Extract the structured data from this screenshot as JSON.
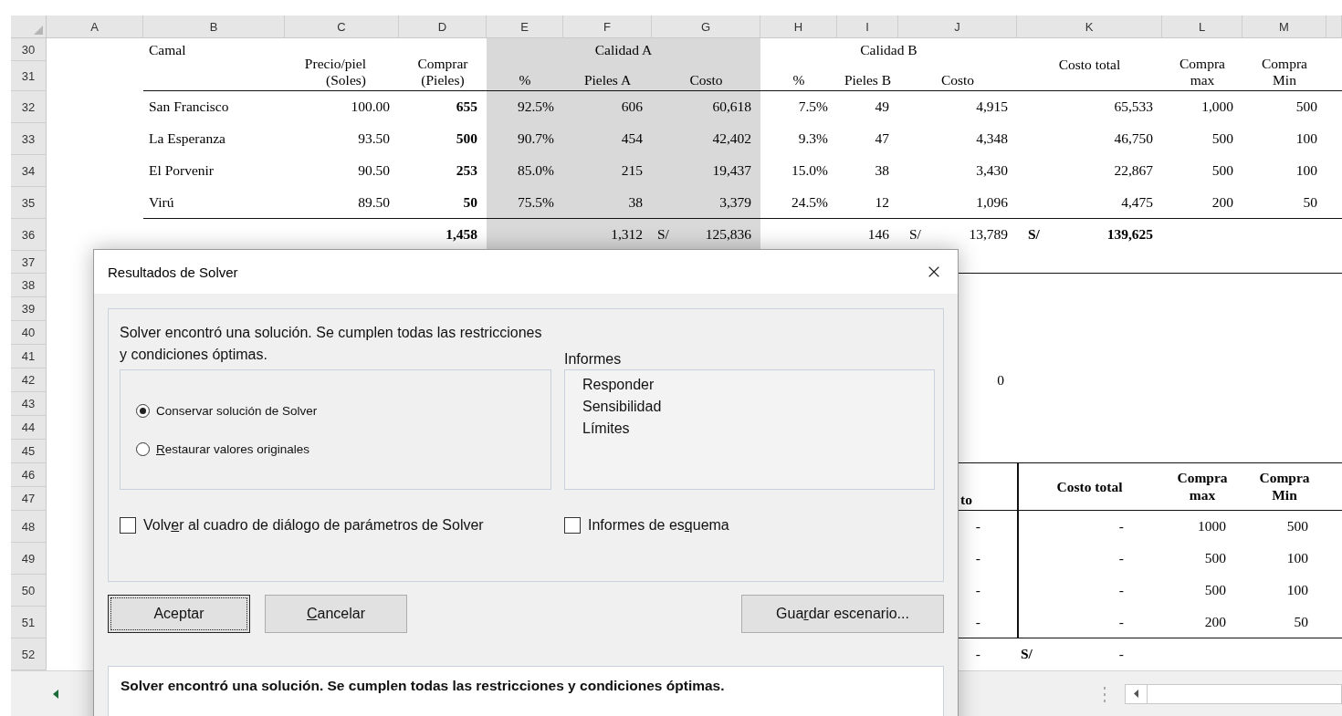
{
  "columns": [
    "A",
    "B",
    "C",
    "D",
    "E",
    "F",
    "G",
    "H",
    "I",
    "J",
    "K",
    "L",
    "M"
  ],
  "row_numbers": [
    "30",
    "31",
    "32",
    "33",
    "34",
    "35",
    "36",
    "37",
    "38",
    "39",
    "40",
    "41",
    "42",
    "43",
    "44",
    "45",
    "46",
    "47",
    "48",
    "49",
    "50",
    "51",
    "52"
  ],
  "top_table": {
    "header": {
      "camal": [
        "Camal"
      ],
      "precio": [
        "Precio/piel",
        "(Soles)"
      ],
      "comprar": [
        "Comprar",
        "(Pieles)"
      ],
      "calidad_a": [
        "Calidad A"
      ],
      "pct_a": [
        "%"
      ],
      "pieles_a": [
        "Pieles A"
      ],
      "costo_a": [
        "Costo"
      ],
      "calidad_b": [
        "Calidad B"
      ],
      "pct_b": [
        "%"
      ],
      "pieles_b": [
        "Pieles B"
      ],
      "costo_b": [
        "Costo"
      ],
      "costo_total": [
        "Costo total"
      ],
      "compra_max": [
        "Compra",
        "max"
      ],
      "compra_min": [
        "Compra",
        "Min"
      ]
    },
    "rows": [
      {
        "camal": "San Francisco",
        "precio": "100.00",
        "comprar": "655",
        "pct_a": "92.5%",
        "pieles_a": "606",
        "costo_a": "60,618",
        "pct_b": "7.5%",
        "pieles_b": "49",
        "costo_b": "4,915",
        "costo_total": "65,533",
        "compra_max": "1,000",
        "compra_min": "500"
      },
      {
        "camal": "La Esperanza",
        "precio": "93.50",
        "comprar": "500",
        "pct_a": "90.7%",
        "pieles_a": "454",
        "costo_a": "42,402",
        "pct_b": "9.3%",
        "pieles_b": "47",
        "costo_b": "4,348",
        "costo_total": "46,750",
        "compra_max": "500",
        "compra_min": "100"
      },
      {
        "camal": "El Porvenir",
        "precio": "90.50",
        "comprar": "253",
        "pct_a": "85.0%",
        "pieles_a": "215",
        "costo_a": "19,437",
        "pct_b": "15.0%",
        "pieles_b": "38",
        "costo_b": "3,430",
        "costo_total": "22,867",
        "compra_max": "500",
        "compra_min": "100"
      },
      {
        "camal": "Virú",
        "precio": "89.50",
        "comprar": "50",
        "pct_a": "75.5%",
        "pieles_a": "38",
        "costo_a": "3,379",
        "pct_b": "24.5%",
        "pieles_b": "12",
        "costo_b": "1,096",
        "costo_total": "4,475",
        "compra_max": "200",
        "compra_min": "50"
      }
    ],
    "totals": {
      "comprar": "1,458",
      "pieles_a": "1,312",
      "currency_a": "S/",
      "costo_a": "125,836",
      "pieles_b": "146",
      "currency_b": "S/",
      "costo_b": "13,789",
      "currency_total": "S/",
      "costo_total": "139,625"
    }
  },
  "stray_value": "0",
  "lower_table": {
    "header": {
      "costo": [
        "to"
      ],
      "costo_total": [
        "Costo total"
      ],
      "compra_max": [
        "Compra",
        "max"
      ],
      "compra_min": [
        "Compra",
        "Min"
      ]
    },
    "rows": [
      {
        "costo": "-",
        "costo_total": "-",
        "compra_max": "1000",
        "compra_min": "500"
      },
      {
        "costo": "-",
        "costo_total": "-",
        "compra_max": "500",
        "compra_min": "100"
      },
      {
        "costo": "-",
        "costo_total": "-",
        "compra_max": "500",
        "compra_min": "100"
      },
      {
        "costo": "-",
        "costo_total": "-",
        "compra_max": "200",
        "compra_min": "50"
      }
    ],
    "totals": {
      "costo": "-",
      "currency": "S/",
      "costo_total": "-"
    }
  },
  "dialog": {
    "title": "Resultados de Solver",
    "message": "Solver encontró una solución. Se cumplen todas las restricciones y condiciones óptimas.",
    "options": [
      {
        "label": {
          "before": "Conservar solución de Solver"
        },
        "selected": true
      },
      {
        "label": {
          "key": "R",
          "after": "estaurar valores originales"
        },
        "selected": false
      }
    ],
    "reports_label": "Informes",
    "reports": [
      "Responder",
      "Sensibilidad",
      "Límites"
    ],
    "checkboxes": [
      {
        "label": {
          "before": "Volv",
          "key": "e",
          "after": "r al cuadro de diálogo de parámetros de Solver"
        },
        "checked": false
      },
      {
        "label": {
          "before": "Informes de es",
          "key": "q",
          "after": "uema"
        },
        "checked": false
      }
    ],
    "buttons": [
      {
        "label": {
          "before": "Aceptar"
        },
        "focused": true
      },
      {
        "label": {
          "key": "C",
          "after": "ancelar"
        },
        "focused": false
      }
    ],
    "save_button": {
      "label": {
        "before": "Gua",
        "key": "r",
        "after": "dar escenario..."
      }
    },
    "status": "Solver encontró una solución. Se cumplen todas las restricciones y condiciones óptimas."
  }
}
